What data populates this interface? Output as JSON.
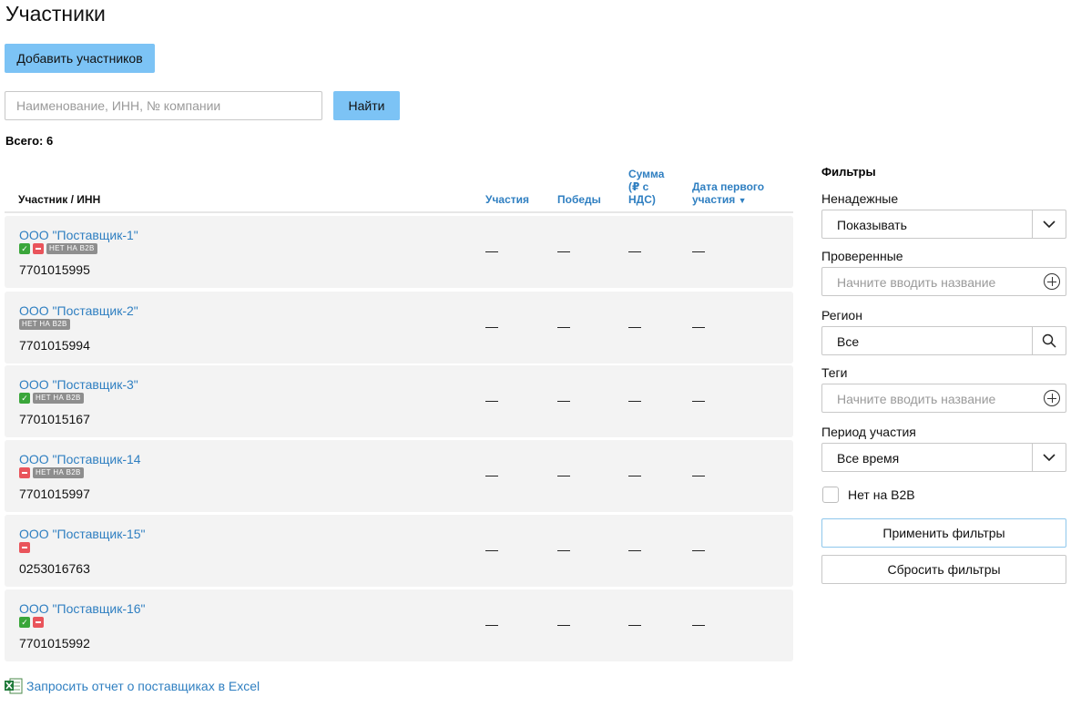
{
  "page": {
    "title": "Участники"
  },
  "toolbar": {
    "add_label": "Добавить участников"
  },
  "search": {
    "placeholder": "Наименование, ИНН, № компании",
    "value": "",
    "button_label": "Найти"
  },
  "summary": {
    "total": "Всего: 6"
  },
  "table": {
    "columns": {
      "participant": "Участник / ИНН",
      "participations": "Участия",
      "wins": "Победы",
      "sum": "Сумма (₽ с НДС)",
      "first_date": "Дата первого участия"
    },
    "sort_indicator": "▼",
    "rows": [
      {
        "name": "ООО \"Поставщик-1\"",
        "inn": "7701015995",
        "badges": [
          "ok",
          "bad",
          "b2b"
        ],
        "participations": "—",
        "wins": "—",
        "sum": "—",
        "first_date": "—"
      },
      {
        "name": "ООО \"Поставщик-2\"",
        "inn": "7701015994",
        "badges": [
          "b2b"
        ],
        "participations": "—",
        "wins": "—",
        "sum": "—",
        "first_date": "—"
      },
      {
        "name": "ООО \"Поставщик-3\"",
        "inn": "7701015167",
        "badges": [
          "ok",
          "b2b"
        ],
        "participations": "—",
        "wins": "—",
        "sum": "—",
        "first_date": "—"
      },
      {
        "name": "ООО \"Поставщик-14",
        "inn": "7701015997",
        "badges": [
          "bad",
          "b2b"
        ],
        "participations": "—",
        "wins": "—",
        "sum": "—",
        "first_date": "—"
      },
      {
        "name": "ООО \"Поставщик-15\"",
        "inn": "0253016763",
        "badges": [
          "bad"
        ],
        "participations": "—",
        "wins": "—",
        "sum": "—",
        "first_date": "—"
      },
      {
        "name": "ООО \"Поставщик-16\"",
        "inn": "7701015992",
        "badges": [
          "ok",
          "bad"
        ],
        "participations": "—",
        "wins": "—",
        "sum": "—",
        "first_date": "—"
      }
    ],
    "b2b_badge_label": "НЕТ НА B2B"
  },
  "excel": {
    "label": "Запросить отчет о поставщиках в Excel",
    "icon": "excel-icon"
  },
  "filters": {
    "title": "Фильтры",
    "unreliable": {
      "label": "Ненадежные",
      "value": "Показывать"
    },
    "verified": {
      "label": "Проверенные",
      "placeholder": "Начните вводить название"
    },
    "region": {
      "label": "Регион",
      "value": "Все"
    },
    "tags": {
      "label": "Теги",
      "placeholder": "Начните вводить название"
    },
    "period": {
      "label": "Период участия",
      "value": "Все время"
    },
    "no_b2b": {
      "label": "Нет на B2B",
      "checked": false
    },
    "apply_label": "Применить фильтры",
    "reset_label": "Сбросить фильтры"
  },
  "colors": {
    "primary_button": "#7cc3f5",
    "link": "#2f7fc1",
    "ok_badge": "#3aa63a",
    "bad_badge": "#e9545b",
    "b2b_badge": "#8e8e8e"
  }
}
